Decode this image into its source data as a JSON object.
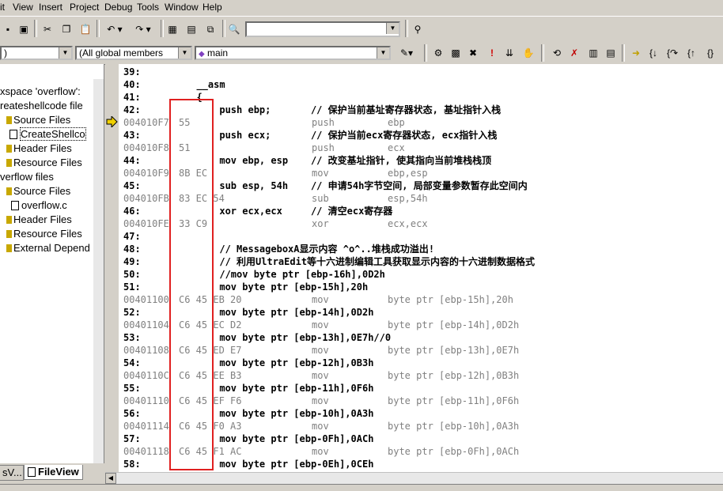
{
  "menu": [
    "it",
    "View",
    "Insert",
    "Project",
    "Debug",
    "Tools",
    "Window",
    "Help"
  ],
  "toolbar": {
    "find_combo_value": "",
    "class_combo_value": ")",
    "members_combo_value": "(All global members",
    "function_combo_value": "main"
  },
  "tree": {
    "items": [
      {
        "label": "xspace 'overflow':",
        "kind": "text"
      },
      {
        "label": "reateshellcode file",
        "kind": "text"
      },
      {
        "label": "Source Files",
        "kind": "folder"
      },
      {
        "label": "CreateShellco",
        "kind": "file"
      },
      {
        "label": "Header Files",
        "kind": "folder"
      },
      {
        "label": "Resource Files",
        "kind": "folder"
      },
      {
        "label": "verflow files",
        "kind": "text"
      },
      {
        "label": "Source Files",
        "kind": "folder"
      },
      {
        "label": "overflow.c",
        "kind": "file"
      },
      {
        "label": "Header Files",
        "kind": "folder"
      },
      {
        "label": "Resource Files",
        "kind": "folder"
      },
      {
        "label": "External Depend",
        "kind": "folder"
      }
    ],
    "tabs": [
      "sV...",
      "FileView"
    ]
  },
  "code": [
    {
      "type": "src",
      "ln": "39:",
      "text": ""
    },
    {
      "type": "src",
      "ln": "40:",
      "text": "  __asm"
    },
    {
      "type": "src",
      "ln": "41:",
      "text": "  {"
    },
    {
      "type": "src",
      "ln": "42:",
      "text": "      push ebp;       // 保护当前基址寄存器状态, 基址指针入栈"
    },
    {
      "type": "dis",
      "addr": "004010F7",
      "bytes": "55",
      "mn": "push",
      "op": "ebp",
      "current": true
    },
    {
      "type": "src",
      "ln": "43:",
      "text": "      push ecx;       // 保护当前ecx寄存器状态, ecx指针入栈"
    },
    {
      "type": "dis",
      "addr": "004010F8",
      "bytes": "51",
      "mn": "push",
      "op": "ecx"
    },
    {
      "type": "src",
      "ln": "44:",
      "text": "      mov ebp, esp    // 改变基址指针, 使其指向当前堆栈栈顶"
    },
    {
      "type": "dis",
      "addr": "004010F9",
      "bytes": "8B EC",
      "mn": "mov",
      "op": "ebp,esp"
    },
    {
      "type": "src",
      "ln": "45:",
      "text": "      sub esp, 54h    // 申请54h字节空间, 局部变量参数暂存此空间内"
    },
    {
      "type": "dis",
      "addr": "004010FB",
      "bytes": "83 EC 54",
      "mn": "sub",
      "op": "esp,54h"
    },
    {
      "type": "src",
      "ln": "46:",
      "text": "      xor ecx,ecx     // 清空ecx寄存器"
    },
    {
      "type": "dis",
      "addr": "004010FE",
      "bytes": "33 C9",
      "mn": "xor",
      "op": "ecx,ecx"
    },
    {
      "type": "src",
      "ln": "47:",
      "text": ""
    },
    {
      "type": "src",
      "ln": "48:",
      "text": "      // MessageboxA显示内容 ^o^..堆栈成功溢出!"
    },
    {
      "type": "src",
      "ln": "49:",
      "text": "      // 利用UltraEdit等十六进制编辑工具获取显示内容的十六进制数据格式"
    },
    {
      "type": "src",
      "ln": "50:",
      "text": "      //mov byte ptr [ebp-16h],0D2h"
    },
    {
      "type": "src",
      "ln": "51:",
      "text": "      mov byte ptr [ebp-15h],20h"
    },
    {
      "type": "dis",
      "addr": "00401100",
      "bytes": "C6 45 EB 20",
      "mn": "mov",
      "op": "byte ptr [ebp-15h],20h"
    },
    {
      "type": "src",
      "ln": "52:",
      "text": "      mov byte ptr [ebp-14h],0D2h"
    },
    {
      "type": "dis",
      "addr": "00401104",
      "bytes": "C6 45 EC D2",
      "mn": "mov",
      "op": "byte ptr [ebp-14h],0D2h"
    },
    {
      "type": "src",
      "ln": "53:",
      "text": "      mov byte ptr [ebp-13h],0E7h//0"
    },
    {
      "type": "dis",
      "addr": "00401108",
      "bytes": "C6 45 ED E7",
      "mn": "mov",
      "op": "byte ptr [ebp-13h],0E7h"
    },
    {
      "type": "src",
      "ln": "54:",
      "text": "      mov byte ptr [ebp-12h],0B3h"
    },
    {
      "type": "dis",
      "addr": "0040110C",
      "bytes": "C6 45 EE B3",
      "mn": "mov",
      "op": "byte ptr [ebp-12h],0B3h"
    },
    {
      "type": "src",
      "ln": "55:",
      "text": "      mov byte ptr [ebp-11h],0F6h"
    },
    {
      "type": "dis",
      "addr": "00401110",
      "bytes": "C6 45 EF F6",
      "mn": "mov",
      "op": "byte ptr [ebp-11h],0F6h"
    },
    {
      "type": "src",
      "ln": "56:",
      "text": "      mov byte ptr [ebp-10h],0A3h"
    },
    {
      "type": "dis",
      "addr": "00401114",
      "bytes": "C6 45 F0 A3",
      "mn": "mov",
      "op": "byte ptr [ebp-10h],0A3h"
    },
    {
      "type": "src",
      "ln": "57:",
      "text": "      mov byte ptr [ebp-0Fh],0ACh"
    },
    {
      "type": "dis",
      "addr": "00401118",
      "bytes": "C6 45 F1 AC",
      "mn": "mov",
      "op": "byte ptr [ebp-0Fh],0ACh"
    },
    {
      "type": "src",
      "ln": "58:",
      "text": "      mov byte ptr [ebp-0Eh],0CEh"
    }
  ],
  "colors": {
    "highlight_box": "#e02020",
    "current_arrow": "#f0d000",
    "disasm_text": "#808080"
  }
}
